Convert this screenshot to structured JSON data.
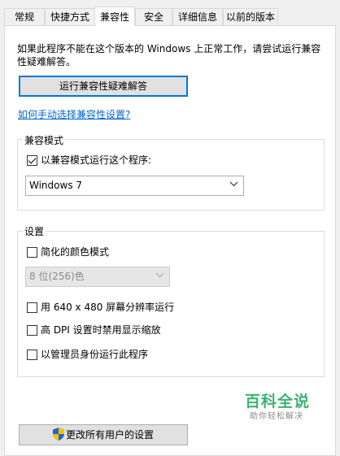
{
  "tabs": [
    {
      "label": "常规"
    },
    {
      "label": "快捷方式"
    },
    {
      "label": "兼容性"
    },
    {
      "label": "安全"
    },
    {
      "label": "详细信息"
    },
    {
      "label": "以前的版本"
    }
  ],
  "active_tab": "兼容性",
  "intro_text": "如果此程序不能在这个版本的 Windows 上正常工作，请尝试运行兼容性疑难解答。",
  "troubleshoot_button": "运行兼容性疑难解答",
  "manual_link": "如何手动选择兼容性设置?",
  "compat_group": {
    "label": "兼容模式",
    "checkbox_label": "以兼容模式运行这个程序:",
    "checked": true,
    "os_selected": "Windows 7"
  },
  "settings_group": {
    "label": "设置",
    "reduced_color": {
      "label": "简化的颜色模式",
      "checked": false
    },
    "color_select": "8 位(256)色",
    "res_640": {
      "label": "用 640 x 480 屏幕分辨率运行",
      "checked": false
    },
    "high_dpi": {
      "label": "高 DPI 设置时禁用显示缩放",
      "checked": false
    },
    "admin": {
      "label": "以管理员身份运行此程序",
      "checked": false
    }
  },
  "watermark": {
    "title": "百科全说",
    "subtitle": "助你轻松解决"
  },
  "all_users_button": "更改所有用户的设置",
  "colors": {
    "accent": "#0078d7",
    "link": "#0066cc",
    "watermark": "#3cb371",
    "shield_blue": "#2a62c9",
    "shield_yellow": "#f2c200"
  }
}
